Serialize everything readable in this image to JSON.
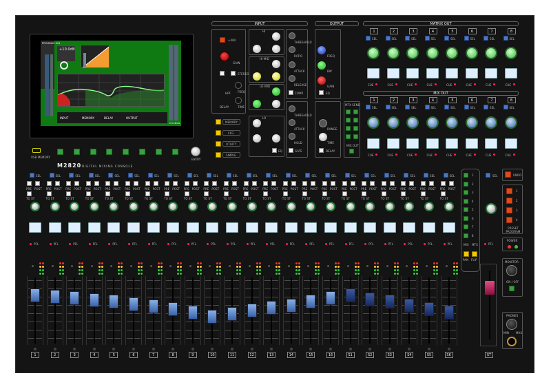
{
  "brand": {
    "model": "M2820",
    "subtitle": "DIGITAL MIXING CONSOLE"
  },
  "usb_label": "USB MEMORY",
  "entry_label": "ENTRY",
  "sections": {
    "input": "INPUT",
    "output": "OUTPUT",
    "matrix_out": "MATRIX OUT",
    "mix_out": "MIX OUT"
  },
  "input": {
    "hpf": "+48V",
    "gain": "GAIN",
    "stereo": "STEREO",
    "phase": "ϕ",
    "freq": "FREQ",
    "hpf_label": "HPF",
    "delay": "DELAY",
    "time": "TIME",
    "eq_bands": [
      "HI",
      "HI-MID",
      "LO-MID",
      "LO"
    ],
    "band_knobs": [
      "FREQ",
      "BW",
      "GAIN"
    ],
    "eq": "EQ",
    "dyn": [
      "THRESHOLD",
      "RATIO",
      "ATTACK",
      "RELEASE",
      "COMP",
      "THRESHOLD",
      "ATTACK",
      "HOLD",
      "GATE"
    ]
  },
  "menu_buttons": [
    "MEMORY",
    "CFG",
    "UTILITY",
    "SIMPLE"
  ],
  "output": {
    "knobs": [
      "FREQ",
      "BW",
      "GAIN"
    ],
    "eq": "EQ",
    "range": "RANGE",
    "time": "TIME",
    "delay": "DELAY",
    "comp_labels": [
      "THRESHOLD",
      "RATIO"
    ]
  },
  "mtx_send": {
    "title": "MTX SEND",
    "mix_out": "MIX OUT"
  },
  "strip": {
    "sel": "SEL",
    "pre": "PRE",
    "post": "POST",
    "to_st": "TO ST",
    "pfl": "PFL",
    "cue": "CUE"
  },
  "channels": [
    "1",
    "2",
    "3",
    "4",
    "5",
    "6",
    "7",
    "8",
    "9",
    "10",
    "11",
    "12",
    "13",
    "14",
    "15",
    "16",
    "S1",
    "S2",
    "S3",
    "S4",
    "S5",
    "S6"
  ],
  "fader_levels": [
    0.82,
    0.8,
    0.78,
    0.75,
    0.72,
    0.68,
    0.64,
    0.6,
    0.55,
    0.48,
    0.52,
    0.58,
    0.62,
    0.66,
    0.72,
    0.78,
    0.82,
    0.76,
    0.72,
    0.66,
    0.6,
    0.54
  ],
  "matrix_numbers": [
    "1",
    "2",
    "3",
    "4",
    "5",
    "6",
    "7",
    "8"
  ],
  "mix_numbers": [
    "1",
    "2",
    "3",
    "4",
    "5",
    "6",
    "7",
    "8"
  ],
  "mix_select": {
    "numbers": [
      "1",
      "2",
      "3",
      "4",
      "5",
      "6",
      "7",
      "8"
    ],
    "mix": "MIX",
    "mtx": "MTX",
    "pan": "PAN",
    "flip": "FLIP"
  },
  "stereo": {
    "label": "ST",
    "sel": "SEL",
    "pfl": "PFL",
    "fader_level": 0.82
  },
  "right": {
    "undo": "UNDO",
    "preset": [
      "1",
      "2",
      "3",
      "4"
    ],
    "preset_title": "PRESET PROGRAM",
    "power": "POWER",
    "monitor": "MONITOR",
    "on_off": "ON / OFF",
    "phones": "PHONES",
    "min": "MIN",
    "max": "MAX"
  },
  "screen": {
    "dsp_label": "PROGRAM 001",
    "readout": "+10.0dB",
    "bottom": [
      "INPUT",
      "MEMORY",
      "DELAY",
      "OUTPUT",
      "STOUT",
      "MON"
    ]
  },
  "colors": {
    "blue_cap": "#5a82c8",
    "dark_cap": "#1c3a7a",
    "red_cap": "#c8205a",
    "screen": "#0f7a12"
  }
}
